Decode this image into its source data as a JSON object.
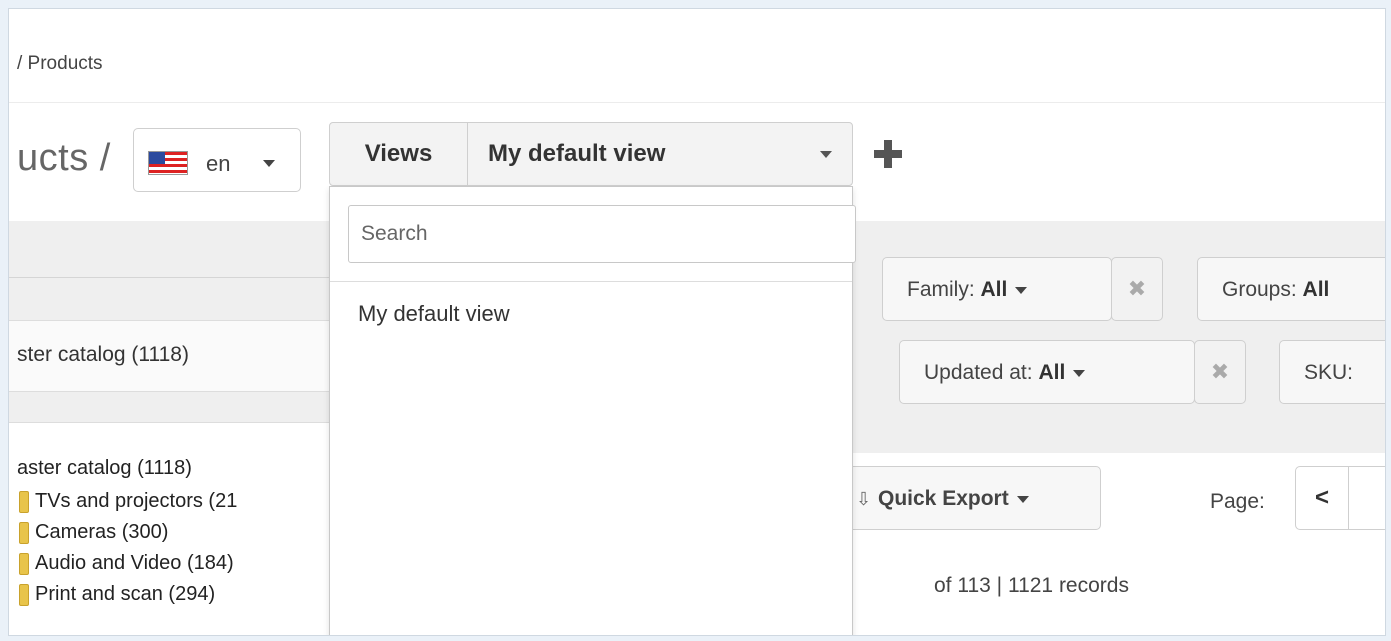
{
  "breadcrumb": "/ Products",
  "page_title": "ucts /",
  "locale": {
    "code": "en",
    "flag_icon": "us-flag-icon"
  },
  "views": {
    "label": "Views",
    "current": "My default view",
    "search_placeholder": "Search",
    "items": [
      "My default view"
    ]
  },
  "tree": {
    "header": "ster catalog (1118)",
    "root": "aster catalog (1118)",
    "items": [
      "TVs and projectors (21",
      "Cameras (300)",
      "Audio and Video (184)",
      "Print and scan (294)"
    ]
  },
  "filters": {
    "family": {
      "label": "Family:",
      "value": "All"
    },
    "groups": {
      "label": "Groups:",
      "value": "All"
    },
    "updated_at": {
      "label": "Updated at:",
      "value": "All"
    },
    "sku": {
      "label": "SKU:"
    },
    "remove_glyph": "✖"
  },
  "toolbar": {
    "quick_export": "Quick Export",
    "page_label": "Page:",
    "prev_glyph": "<",
    "records_text": "of 113 | 1121 records"
  },
  "colors": {
    "background": "#eaf1f8",
    "band": "#efefef",
    "folder": "#e8c44a"
  }
}
